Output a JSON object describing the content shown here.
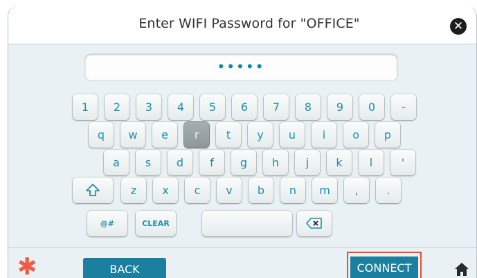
{
  "dialog": {
    "title": "Enter WIFI Password for \"OFFICE\"",
    "close_icon": "close-icon"
  },
  "password": {
    "value": "•••••"
  },
  "keyboard": {
    "row1": [
      "1",
      "2",
      "3",
      "4",
      "5",
      "6",
      "7",
      "8",
      "9",
      "0",
      "-"
    ],
    "row2": [
      "q",
      "w",
      "e",
      "r",
      "t",
      "y",
      "u",
      "i",
      "o",
      "p"
    ],
    "row3": [
      "a",
      "s",
      "d",
      "f",
      "g",
      "h",
      "j",
      "k",
      "l",
      "'"
    ],
    "row4_shift_icon": "shift-icon",
    "row4": [
      "z",
      "x",
      "c",
      "v",
      "b",
      "n",
      "m",
      ",",
      "."
    ],
    "row5": {
      "symbols_label": "@#",
      "clear_label": "CLEAR",
      "space_label": "",
      "backspace_icon": "backspace-icon"
    },
    "active_key": "r"
  },
  "footer": {
    "asterisk_icon": "asterisk-icon",
    "back_label": "BACK",
    "connect_label": "CONNECT",
    "home_icon": "home-icon"
  },
  "colors": {
    "accent": "#1b7fa0",
    "key_text": "#1e8fab",
    "highlight": "#ee4a30",
    "asterisk": "#f05c4a"
  }
}
